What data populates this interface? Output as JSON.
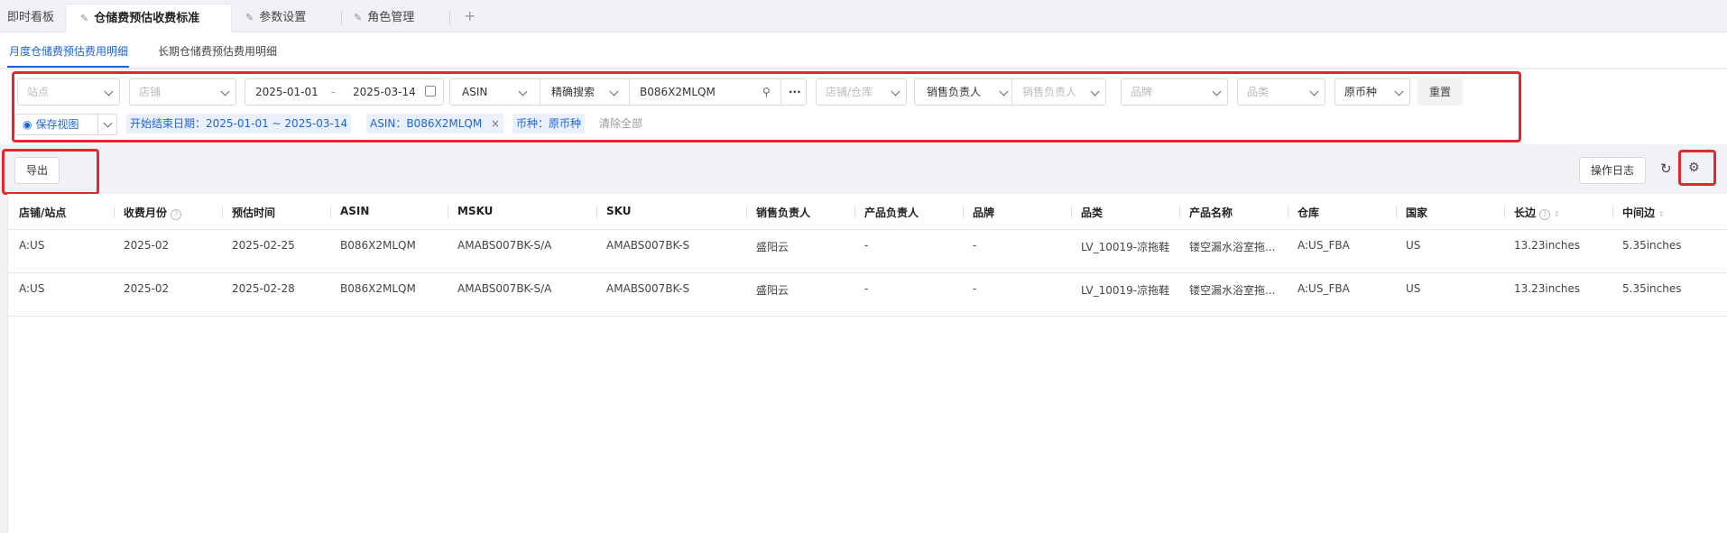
{
  "tabs": {
    "home": "即时看板",
    "active": "仓储费预估收费标准",
    "params": "参数设置",
    "roles": "角色管理",
    "add": "+"
  },
  "subtabs": {
    "monthly": "月度仓储费预估费用明细",
    "longterm": "长期仓储费预估费用明细"
  },
  "filters": {
    "site": "站点",
    "store": "店铺",
    "date_start": "2025-01-01",
    "date_sep": "-",
    "date_end": "2025-03-14",
    "asin_type": "ASIN",
    "search_mode": "精确搜索",
    "search_value": "B086X2MLQM",
    "more": "···",
    "store_warehouse": "店铺/仓库",
    "sales_owner_select": "销售负责人",
    "sales_owner_placeholder": "销售负责人",
    "brand": "品牌",
    "category": "品类",
    "currency": "原币种",
    "reset": "重置",
    "save_view": "保存视图",
    "chips": {
      "date": "开始结束日期：2025-01-01 ~ 2025-03-14",
      "asin": "ASIN：B086X2MLQM",
      "currency": "币种：原币种"
    },
    "clear_all": "清除全部"
  },
  "toolbar": {
    "export": "导出",
    "log": "操作日志"
  },
  "table": {
    "headers": {
      "store_site": "店铺/站点",
      "month": "收费月份",
      "est_time": "预估时间",
      "asin": "ASIN",
      "msku": "MSKU",
      "sku": "SKU",
      "sales_owner": "销售负责人",
      "product_owner": "产品负责人",
      "brand": "品牌",
      "category": "品类",
      "product_name": "产品名称",
      "warehouse": "仓库",
      "country": "国家",
      "long_side": "长边",
      "mid_side": "中间边"
    },
    "rows": [
      {
        "store_site": "A:US",
        "month": "2025-02",
        "est_time": "2025-02-25",
        "asin": "B086X2MLQM",
        "msku": "AMABS007BK-S/A",
        "sku": "AMABS007BK-S",
        "sales_owner": "盛阳云",
        "product_owner": "-",
        "brand": "-",
        "category": "LV_10019-凉拖鞋",
        "product_name": "镂空漏水浴室拖...",
        "warehouse": "A:US_FBA",
        "country": "US",
        "long_side": "13.23inches",
        "mid_side": "5.35inches"
      },
      {
        "store_site": "A:US",
        "month": "2025-02",
        "est_time": "2025-02-28",
        "asin": "B086X2MLQM",
        "msku": "AMABS007BK-S/A",
        "sku": "AMABS007BK-S",
        "sales_owner": "盛阳云",
        "product_owner": "-",
        "brand": "-",
        "category": "LV_10019-凉拖鞋",
        "product_name": "镂空漏水浴室拖...",
        "warehouse": "A:US_FBA",
        "country": "US",
        "long_side": "13.23inches",
        "mid_side": "5.35inches"
      }
    ]
  },
  "colors": {
    "accent": "#1e63d6",
    "highlight": "#e0282e"
  }
}
